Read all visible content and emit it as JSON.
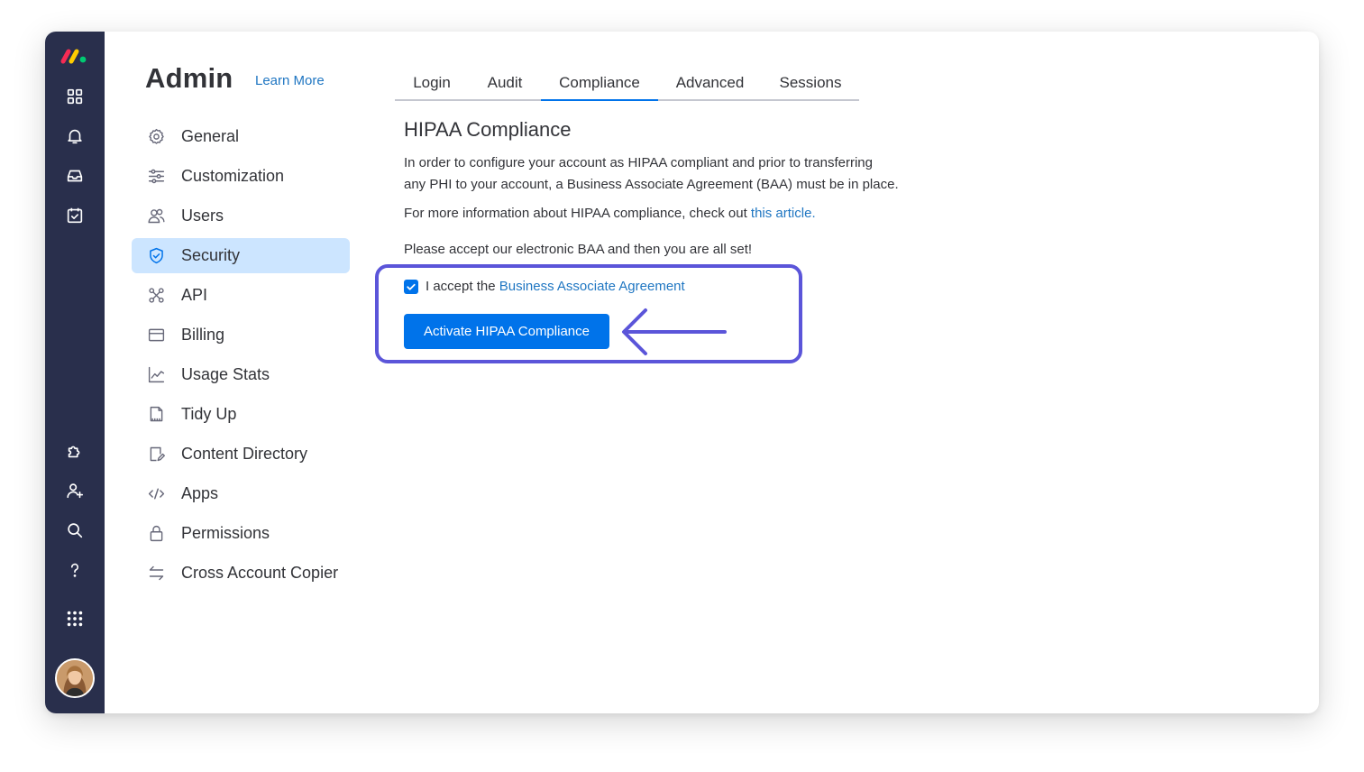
{
  "sidebar": {
    "avatar_alt": "User avatar"
  },
  "header": {
    "title": "Admin",
    "learn_more": "Learn More"
  },
  "nav": {
    "items": [
      {
        "label": "General",
        "icon": "gear-icon"
      },
      {
        "label": "Customization",
        "icon": "sliders-icon"
      },
      {
        "label": "Users",
        "icon": "users-icon"
      },
      {
        "label": "Security",
        "icon": "shield-icon",
        "active": true
      },
      {
        "label": "API",
        "icon": "api-icon"
      },
      {
        "label": "Billing",
        "icon": "credit-card-icon"
      },
      {
        "label": "Usage Stats",
        "icon": "chart-icon"
      },
      {
        "label": "Tidy Up",
        "icon": "receipt-icon"
      },
      {
        "label": "Content Directory",
        "icon": "document-edit-icon"
      },
      {
        "label": "Apps",
        "icon": "code-icon"
      },
      {
        "label": "Permissions",
        "icon": "lock-icon"
      },
      {
        "label": "Cross Account Copier",
        "icon": "transfer-arrows-icon"
      }
    ]
  },
  "tabs": [
    {
      "label": "Login"
    },
    {
      "label": "Audit"
    },
    {
      "label": "Compliance",
      "active": true
    },
    {
      "label": "Advanced"
    },
    {
      "label": "Sessions"
    }
  ],
  "compliance": {
    "title": "HIPAA Compliance",
    "intro_line1": "In order to configure your account as HIPAA compliant and prior to transferring",
    "intro_line2": "any PHI to your account, a Business Associate Agreement (BAA) must be in place.",
    "more_info_prefix": "For more information about HIPAA compliance, check out ",
    "more_info_link": "this article",
    "more_info_suffix": ".",
    "accept_prompt": "Please accept our electronic BAA and then you are all set!",
    "accept_prefix": "I accept the ",
    "accept_link": "Business Associate Agreement",
    "accept_checked": true,
    "activate_button": "Activate HIPAA Compliance"
  },
  "colors": {
    "rail_bg": "#292f4c",
    "primary": "#0073ea",
    "link": "#1f76c2",
    "active_nav_bg": "#cce5ff",
    "highlight_border": "#5b55d9"
  }
}
